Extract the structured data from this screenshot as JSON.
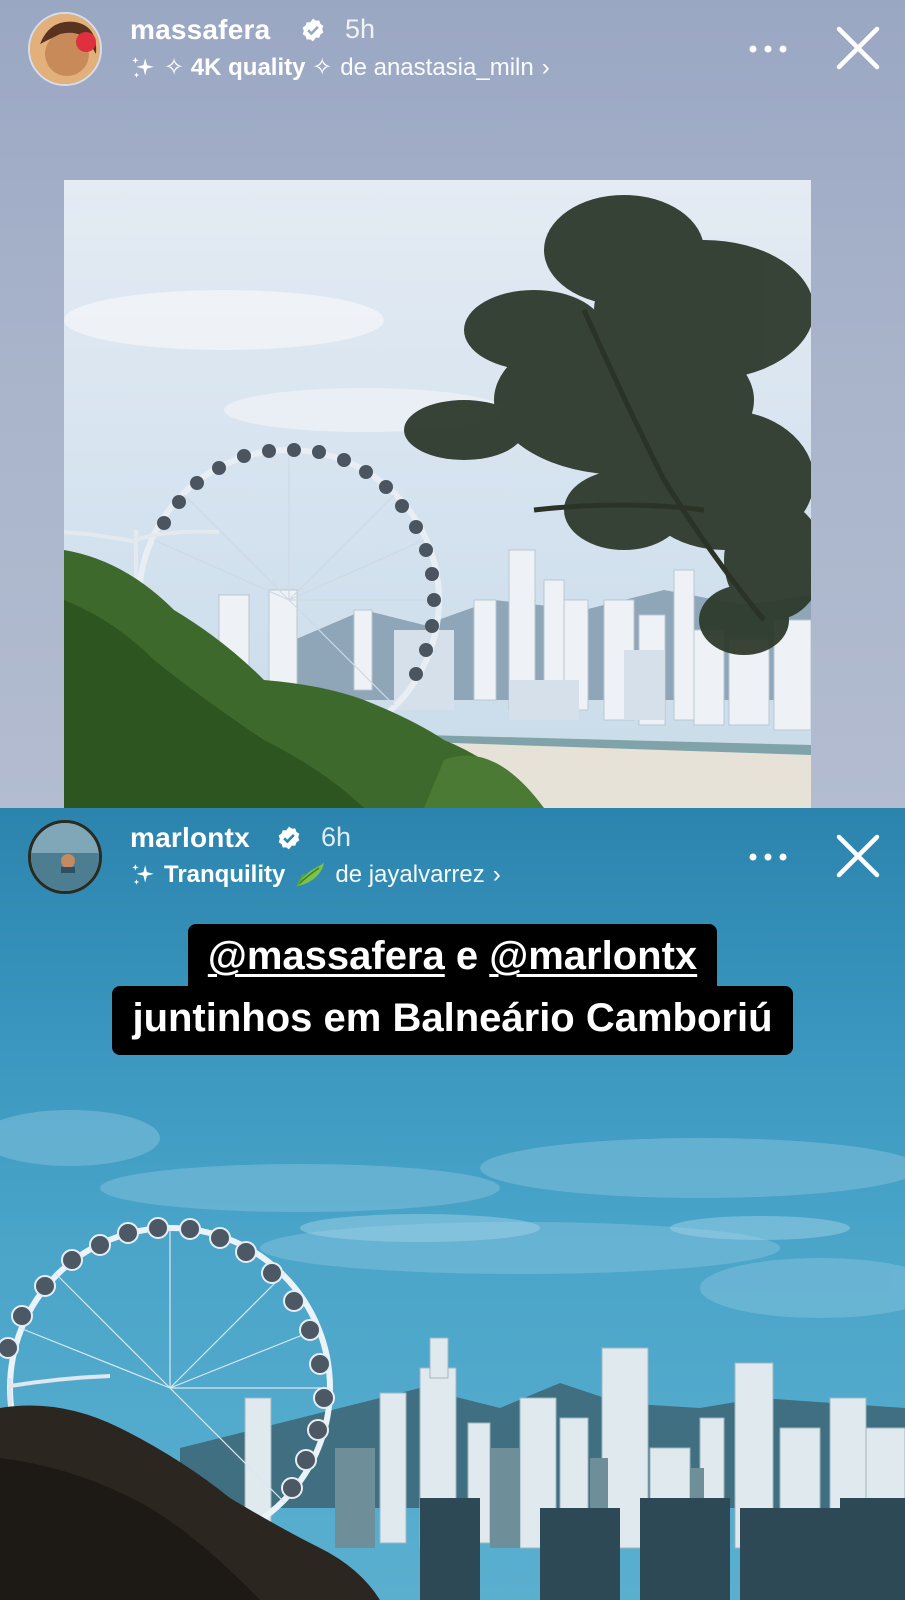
{
  "stories": [
    {
      "user": "massafera",
      "time": "5h",
      "music": {
        "sparkle_icon": "sparkles-icon",
        "title": "✧ 4K quality ✧",
        "by": "de anastasia_miln",
        "chevron": "›"
      }
    },
    {
      "user": "marlontx",
      "time": "6h",
      "music": {
        "sparkle_icon": "sparkles-icon",
        "title": "Tranquility",
        "emoji": "🌿",
        "by": "de jayalvarrez",
        "chevron": "›"
      }
    }
  ],
  "caption": {
    "line1_mention1": "@massafera",
    "line1_and": " e ",
    "line1_mention2": "@marlontx",
    "line2": "juntinhos em Balneário Camboriú"
  },
  "icons": [
    "verified-badge-icon",
    "more-options-icon",
    "close-icon"
  ],
  "colors": {
    "verified": "#ffffff",
    "caption_bg": "#000000",
    "story1_bg": "#a9b4cb",
    "story2_sky": "#3b97bf"
  }
}
